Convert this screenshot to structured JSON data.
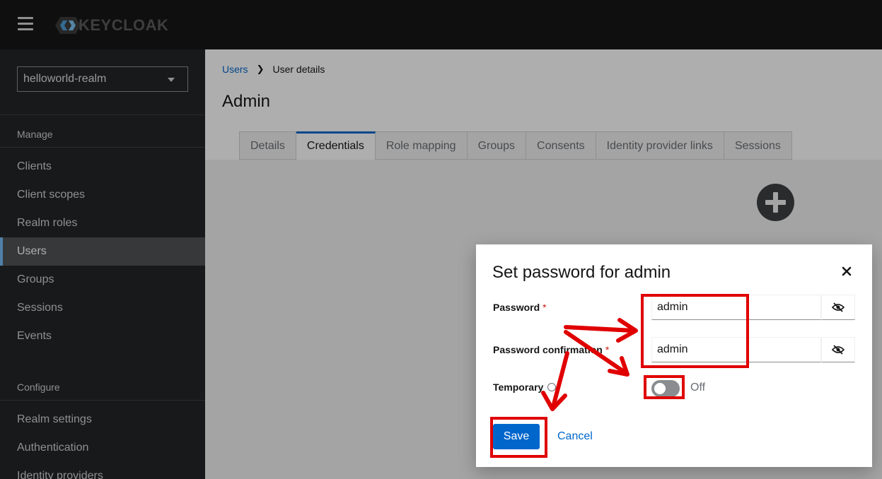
{
  "header": {
    "logo_text": "KEYCLOAK",
    "icons": [
      "hamburger-icon",
      "keycloak-logo"
    ]
  },
  "sidebar": {
    "realm": "helloworld-realm",
    "sections": [
      {
        "title": "Manage",
        "items": [
          "Clients",
          "Client scopes",
          "Realm roles",
          "Users",
          "Groups",
          "Sessions",
          "Events"
        ]
      },
      {
        "title": "Configure",
        "items": [
          "Realm settings",
          "Authentication",
          "Identity providers"
        ]
      }
    ],
    "active_item": "Users"
  },
  "main": {
    "breadcrumb": {
      "link": "Users",
      "current": "User details"
    },
    "title": "Admin",
    "tabs": [
      "Details",
      "Credentials",
      "Role mapping",
      "Groups",
      "Consents",
      "Identity provider links",
      "Sessions"
    ],
    "active_tab": "Credentials"
  },
  "modal": {
    "title": "Set password for admin",
    "password_label": "Password",
    "password_value": "admin",
    "confirm_label": "Password confirmation",
    "confirm_value": "admin",
    "required_mark": "*",
    "temporary_label": "Temporary",
    "temporary_state": "Off",
    "save_label": "Save",
    "cancel_label": "Cancel"
  },
  "colors": {
    "accent": "#0066cc",
    "annotation": "#e00000",
    "sidebar_bg": "#212427",
    "masthead_bg": "#151515"
  }
}
